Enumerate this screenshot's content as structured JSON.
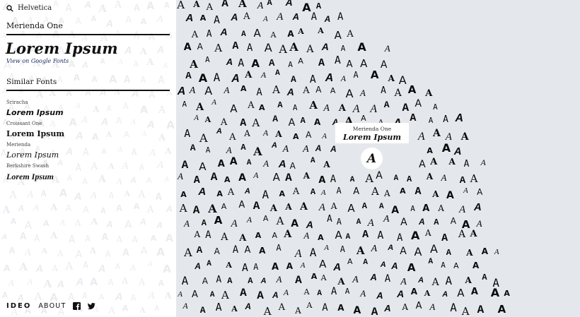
{
  "search": {
    "value": "Helvetica"
  },
  "selected_font": {
    "name": "Merienda One",
    "preview_text": "Lorem Ipsum",
    "link_label": "View on Google Fonts"
  },
  "similar": {
    "title": "Similar Fonts",
    "items": [
      {
        "name": "Sriracha",
        "sample": "Lorem Ipsum"
      },
      {
        "name": "Croissant One",
        "sample": "Lorem Ipsum"
      },
      {
        "name": "Merienda",
        "sample": "Lorem Ipsum"
      },
      {
        "name": "Berkshire Swash",
        "sample": "Lorem Ipsum"
      }
    ]
  },
  "footer": {
    "logo": "IDEO",
    "about_label": "ABOUT",
    "icons": [
      "facebook-icon",
      "twitter-icon"
    ]
  },
  "tooltip": {
    "name": "Merienda One",
    "sample": "Lorem Ipsum"
  },
  "glyph_char": "A",
  "colors": {
    "canvas_bg": "#e4e8ec",
    "sidebar_bg": "#ffffff",
    "ink": "#0b0b0b",
    "faint": "#e9ecef"
  }
}
